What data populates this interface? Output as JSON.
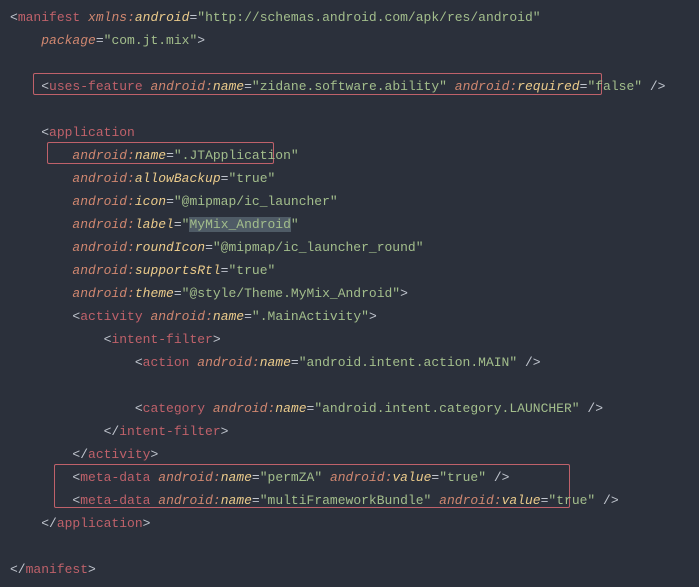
{
  "code": {
    "manifest_open": "manifest",
    "xmlns": "xmlns",
    "android_ns": "android",
    "xmlns_val": "\"http://schemas.android.com/apk/res/android\"",
    "package_attr": "package",
    "package_val": "\"com.jt.mix\"",
    "uses_feature": "uses-feature",
    "name_attr": "name",
    "uf_name_val": "\"zidane.software.ability\"",
    "required_attr": "required",
    "required_val": "\"false\"",
    "application": "application",
    "app_name_val": "\".JTApplication\"",
    "allowBackup": "allowBackup",
    "true_val": "\"true\"",
    "icon_attr": "icon",
    "icon_val": "\"@mipmap/ic_launcher\"",
    "label_attr": "label",
    "label_val_open": "\"",
    "label_val_text": "MyMix_Android",
    "label_val_close": "\"",
    "roundIcon": "roundIcon",
    "roundIcon_val": "\"@mipmap/ic_launcher_round\"",
    "supportsRtl": "supportsRtl",
    "theme_attr": "theme",
    "theme_val": "\"@style/Theme.MyMix_Android\"",
    "activity": "activity",
    "activity_name_val": "\".MainActivity\"",
    "intent_filter": "intent-filter",
    "action": "action",
    "action_val": "\"android.intent.action.MAIN\"",
    "category": "category",
    "category_val": "\"android.intent.category.LAUNCHER\"",
    "meta_data": "meta-data",
    "meta1_name": "\"permZA\"",
    "value_attr": "value",
    "meta2_name": "\"multiFrameworkBundle\""
  }
}
